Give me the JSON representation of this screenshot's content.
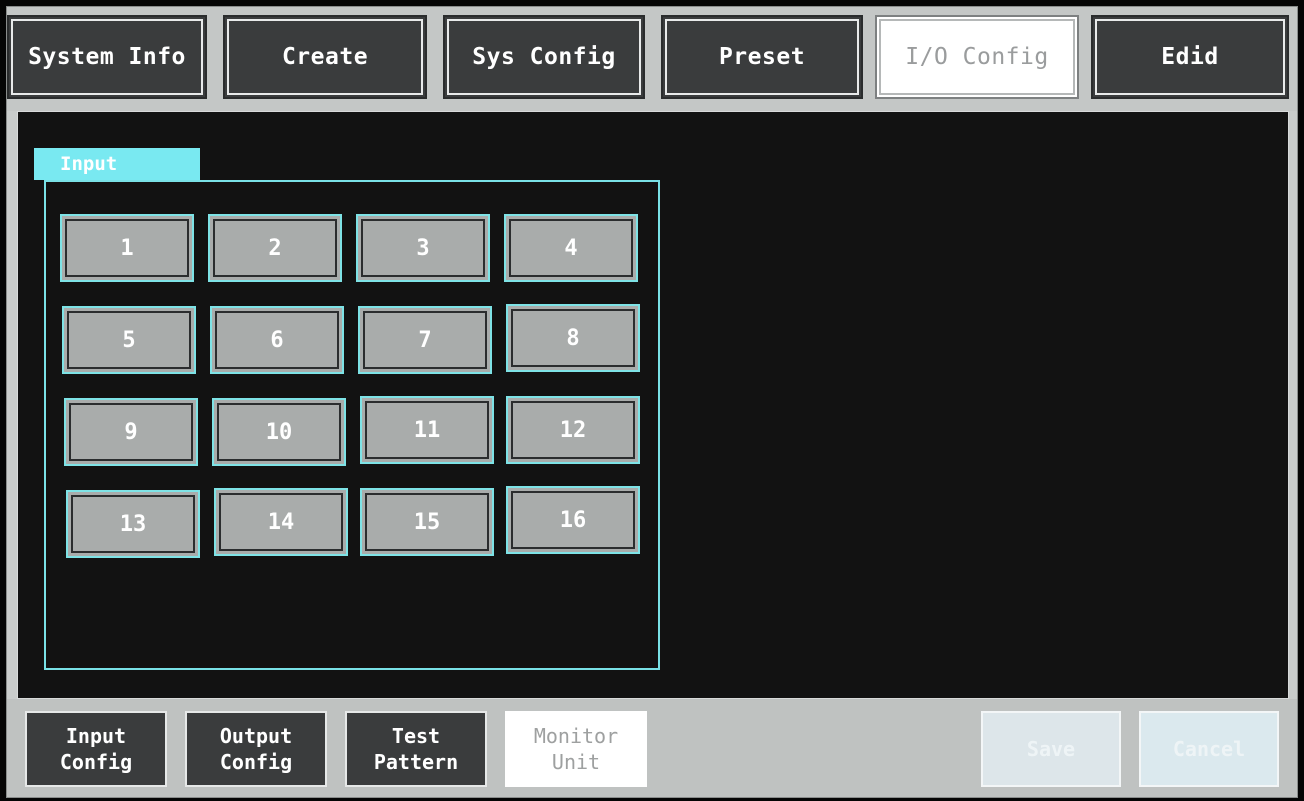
{
  "top_tabs": [
    {
      "label": "System Info"
    },
    {
      "label": "Create"
    },
    {
      "label": "Sys Config"
    },
    {
      "label": "Preset"
    },
    {
      "label": "I/O Config"
    },
    {
      "label": "Edid"
    }
  ],
  "active_top_tab": "I/O Config",
  "input_group": {
    "title": "Input",
    "inputs": [
      "1",
      "2",
      "3",
      "4",
      "5",
      "6",
      "7",
      "8",
      "9",
      "10",
      "11",
      "12",
      "13",
      "14",
      "15",
      "16"
    ]
  },
  "bottom_tabs": [
    {
      "line1": "Input",
      "line2": "Config"
    },
    {
      "line1": "Output",
      "line2": "Config"
    },
    {
      "line1": "Test",
      "line2": "Pattern"
    },
    {
      "line1": "Monitor",
      "line2": "Unit"
    }
  ],
  "active_bottom_tab": "Monitor Unit",
  "actions": {
    "save_label": "Save",
    "cancel_label": "Cancel"
  },
  "colors": {
    "accent_cyan": "#79e9f1",
    "button_gray": "#a9acab",
    "tab_dark": "#3a3c3d",
    "panel_black": "#121212"
  }
}
